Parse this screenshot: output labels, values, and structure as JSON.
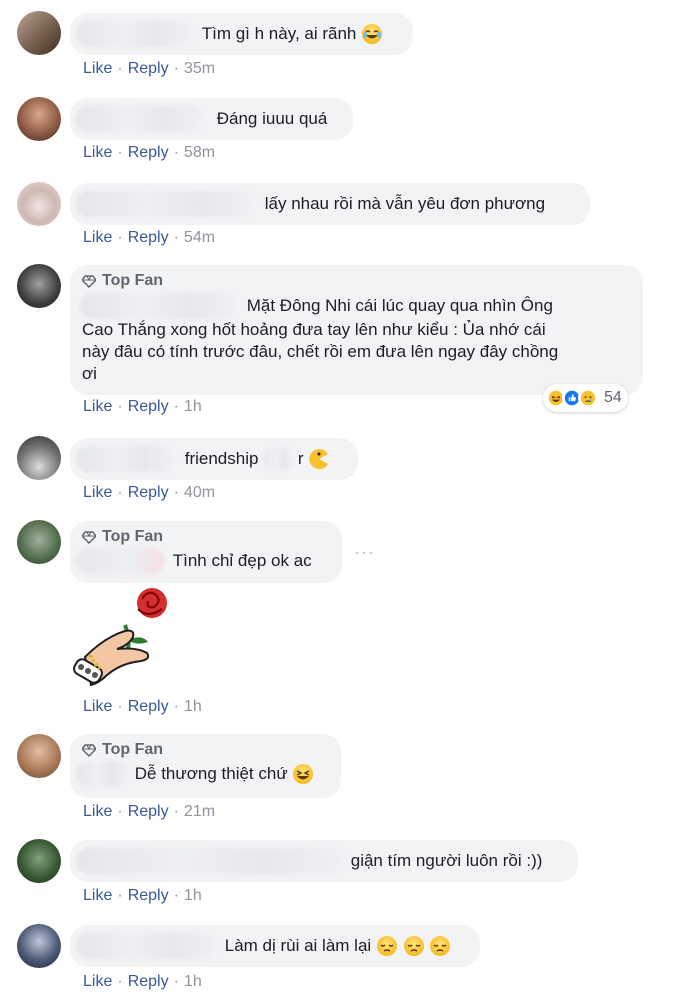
{
  "labels": {
    "like": "Like",
    "reply": "Reply",
    "sep": "·",
    "top_fan": "Top Fan"
  },
  "colors": {
    "link": "#385898",
    "meta": "#90949c",
    "bubble": "#f2f3f5",
    "text": "#1c1e21"
  },
  "comments": [
    {
      "text": "Tìm gì h này, ai rãnh",
      "emoji": "rolling-laughing-emoji",
      "time": "35m"
    },
    {
      "text": "Đáng iuuu quá",
      "time": "58m"
    },
    {
      "text": "lấy nhau rồi mà vẫn yêu đơn phương",
      "time": "54m"
    },
    {
      "top_fan": true,
      "lines": [
        "Mặt Đông Nhi cái lúc quay qua nhìn Ông",
        "Cao Thắng xong hốt hoảng đưa tay lên như kiểu : Ủa nhớ cái",
        "này đâu có tính trước đâu, chết rồi em đưa lên ngay đây chồng",
        "ơi"
      ],
      "reactions": {
        "icons": [
          "haha-reaction-icon",
          "like-reaction-icon",
          "sad-reaction-icon"
        ],
        "count": "54"
      },
      "time": "1h"
    },
    {
      "text_a": "friendship",
      "text_b": "r",
      "emoji": "pacman-emoji",
      "time": "40m"
    },
    {
      "top_fan": true,
      "text": "Tình chỉ đẹp ok ac",
      "sticker": "hand-holding-rose-sticker",
      "time": "1h"
    },
    {
      "top_fan": true,
      "text": "Dễ thương thiệt chứ",
      "emoji": "laughing-emoji",
      "time": "21m"
    },
    {
      "text": "giận tím người luôn rồi :))",
      "time": "1h"
    },
    {
      "text": "Làm dị rùi ai làm lại",
      "emoji": "pensive-emoji",
      "time": "1h"
    }
  ]
}
